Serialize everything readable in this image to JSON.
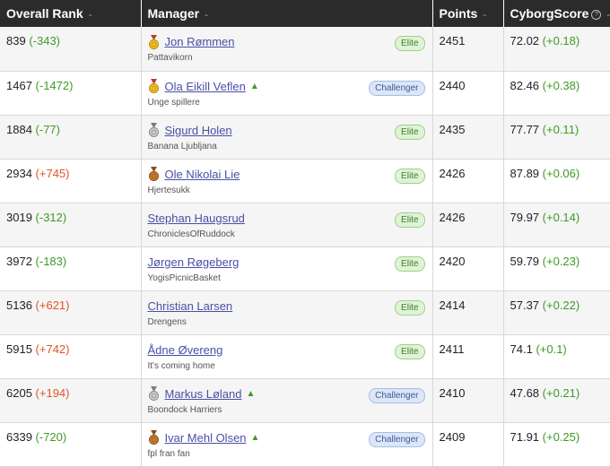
{
  "header": {
    "col_rank": "Overall Rank",
    "col_manager": "Manager",
    "col_points": "Points",
    "col_score": "CyborgScore",
    "sort_icon": "-",
    "help_icon": "?"
  },
  "colors": {
    "header_bg": "#2b2b2b",
    "negative_change": "#3e9b22",
    "positive_change": "#e0542a",
    "manager_link": "#4a4fa6"
  },
  "rows": [
    {
      "rank": "839",
      "change": "(-343)",
      "change_dir": "neg",
      "medal": "gold",
      "manager": "Jon Rømmen",
      "up": "",
      "team": "Pattavikorn",
      "badge": "Elite",
      "points": "2451",
      "score": "72.02",
      "score_change": "(+0.18)"
    },
    {
      "rank": "1467",
      "change": "(-1472)",
      "change_dir": "neg",
      "medal": "gold",
      "manager": "Ola Eikill Veflen",
      "up": "▲",
      "team": "Unge spillere",
      "badge": "Challenger",
      "points": "2440",
      "score": "82.46",
      "score_change": "(+0.38)"
    },
    {
      "rank": "1884",
      "change": "(-77)",
      "change_dir": "neg",
      "medal": "silver",
      "manager": "Sigurd Holen",
      "up": "",
      "team": "Banana Ljubljana",
      "badge": "Elite",
      "points": "2435",
      "score": "77.77",
      "score_change": "(+0.11)"
    },
    {
      "rank": "2934",
      "change": "(+745)",
      "change_dir": "pos",
      "medal": "bronze",
      "manager": "Ole Nikolai Lie",
      "up": "",
      "team": "Hjertesukk",
      "badge": "Elite",
      "points": "2426",
      "score": "87.89",
      "score_change": "(+0.06)"
    },
    {
      "rank": "3019",
      "change": "(-312)",
      "change_dir": "neg",
      "medal": "",
      "manager": "Stephan Haugsrud",
      "up": "",
      "team": "ChroniclesOfRuddock",
      "badge": "Elite",
      "points": "2426",
      "score": "79.97",
      "score_change": "(+0.14)"
    },
    {
      "rank": "3972",
      "change": "(-183)",
      "change_dir": "neg",
      "medal": "",
      "manager": "Jørgen Røgeberg",
      "up": "",
      "team": "YogisPicnicBasket",
      "badge": "Elite",
      "points": "2420",
      "score": "59.79",
      "score_change": "(+0.23)"
    },
    {
      "rank": "5136",
      "change": "(+621)",
      "change_dir": "pos",
      "medal": "",
      "manager": "Christian Larsen",
      "up": "",
      "team": "Drengens",
      "badge": "Elite",
      "points": "2414",
      "score": "57.37",
      "score_change": "(+0.22)"
    },
    {
      "rank": "5915",
      "change": "(+742)",
      "change_dir": "pos",
      "medal": "",
      "manager": "Ådne Øvereng",
      "up": "",
      "team": "It's coming home",
      "badge": "Elite",
      "points": "2411",
      "score": "74.1",
      "score_change": "(+0.1)"
    },
    {
      "rank": "6205",
      "change": "(+194)",
      "change_dir": "pos",
      "medal": "silver",
      "manager": "Markus Løland",
      "up": "▲",
      "team": "Boondock Harriers",
      "badge": "Challenger",
      "points": "2410",
      "score": "47.68",
      "score_change": "(+0.21)"
    },
    {
      "rank": "6339",
      "change": "(-720)",
      "change_dir": "neg",
      "medal": "bronze",
      "manager": "Ivar Mehl Olsen",
      "up": "▲",
      "team": "fpl fran fan",
      "badge": "Challenger",
      "points": "2409",
      "score": "71.91",
      "score_change": "(+0.25)"
    }
  ]
}
